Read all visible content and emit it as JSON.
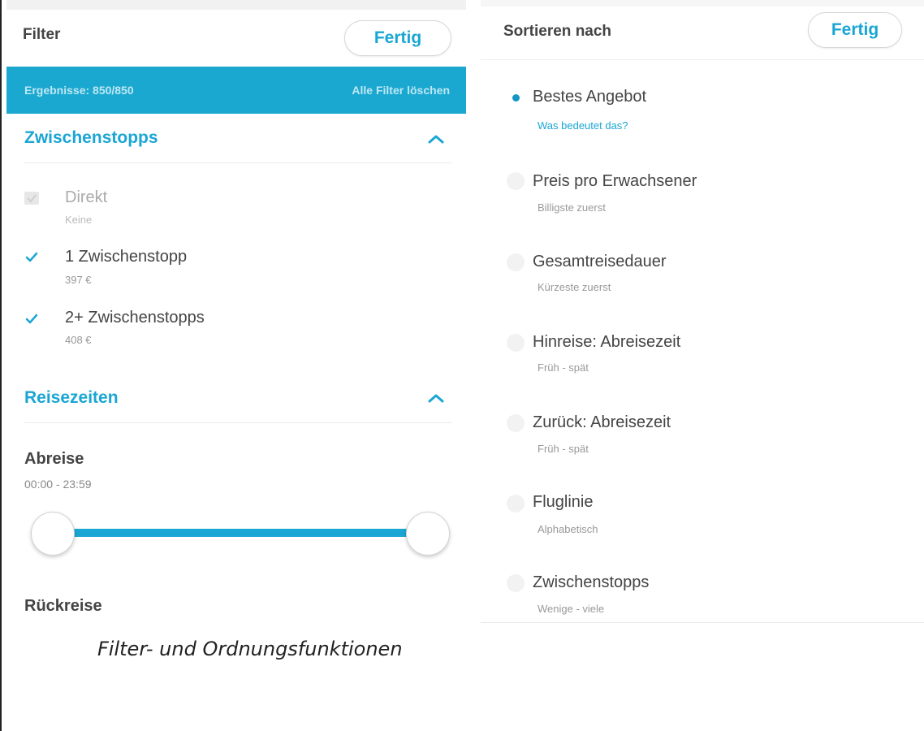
{
  "filter_panel": {
    "title": "Filter",
    "done_label": "Fertig",
    "results_text": "Ergebnisse: 850/850",
    "clear_all_label": "Alle Filter löschen",
    "stops_section": {
      "title": "Zwischenstopps",
      "options": [
        {
          "label": "Direkt",
          "sub": "Keine",
          "checked": false,
          "disabled": true
        },
        {
          "label": "1 Zwischenstopp",
          "sub": "397 €",
          "checked": true,
          "disabled": false
        },
        {
          "label": "2+ Zwischenstopps",
          "sub": "408 €",
          "checked": true,
          "disabled": false
        }
      ]
    },
    "times_section": {
      "title": "Reisezeiten",
      "departure_label": "Abreise",
      "departure_range": "00:00 - 23:59",
      "return_label": "Rückreise"
    }
  },
  "sort_panel": {
    "title": "Sortieren nach",
    "done_label": "Fertig",
    "options": [
      {
        "label": "Bestes Angebot",
        "sub": "Was bedeutet das?",
        "selected": true
      },
      {
        "label": "Preis pro Erwachsener",
        "sub": "Billigste zuerst",
        "selected": false
      },
      {
        "label": "Gesamtreisedauer",
        "sub": "Kürzeste zuerst",
        "selected": false
      },
      {
        "label": "Hinreise: Abreisezeit",
        "sub": "Früh - spät",
        "selected": false
      },
      {
        "label": "Zurück: Abreisezeit",
        "sub": "Früh - spät",
        "selected": false
      },
      {
        "label": "Fluglinie",
        "sub": "Alphabetisch",
        "selected": false
      },
      {
        "label": "Zwischenstopps",
        "sub": "Wenige - viele",
        "selected": false
      }
    ]
  },
  "caption": "Filter- und Ordnungsfunktionen",
  "colors": {
    "accent": "#1aa6d4",
    "result_bar": "#1aa8d0",
    "text": "#444444",
    "subtext": "#999999"
  }
}
